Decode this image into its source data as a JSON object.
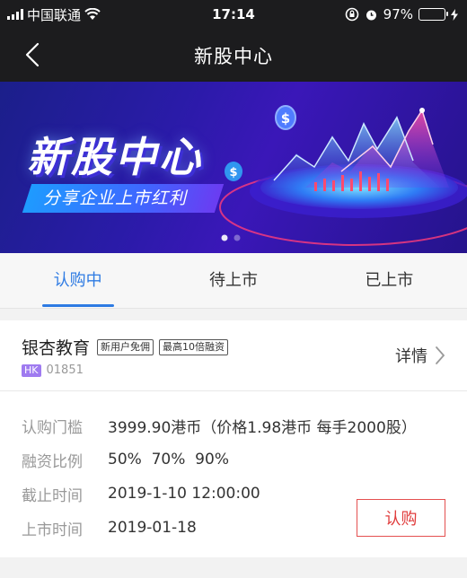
{
  "status": {
    "carrier": "中国联通",
    "time": "17:14",
    "battery": "97%"
  },
  "nav": {
    "title": "新股中心"
  },
  "banner": {
    "headline": "新股中心",
    "subtitle": "分享企业上市红利"
  },
  "tabs": [
    {
      "label": "认购中",
      "active": true
    },
    {
      "label": "待上市",
      "active": false
    },
    {
      "label": "已上市",
      "active": false
    }
  ],
  "stock": {
    "name": "银杏教育",
    "badges": [
      "新用户免佣",
      "最高10倍融资"
    ],
    "market": "HK",
    "code": "01851",
    "detail_label": "详情",
    "rows": [
      {
        "key": "认购门槛",
        "value": "3999.90港币（价格1.98港币 每手2000股）"
      },
      {
        "key": "融资比例",
        "value": "50%  70%  90%"
      },
      {
        "key": "截止时间",
        "value": "2019-1-10 12:00:00"
      },
      {
        "key": "上市时间",
        "value": "2019-01-18"
      }
    ],
    "buy_label": "认购"
  },
  "colors": {
    "accent": "#2e7be3",
    "buy": "#e03c3c",
    "battery": "#4cd964"
  }
}
